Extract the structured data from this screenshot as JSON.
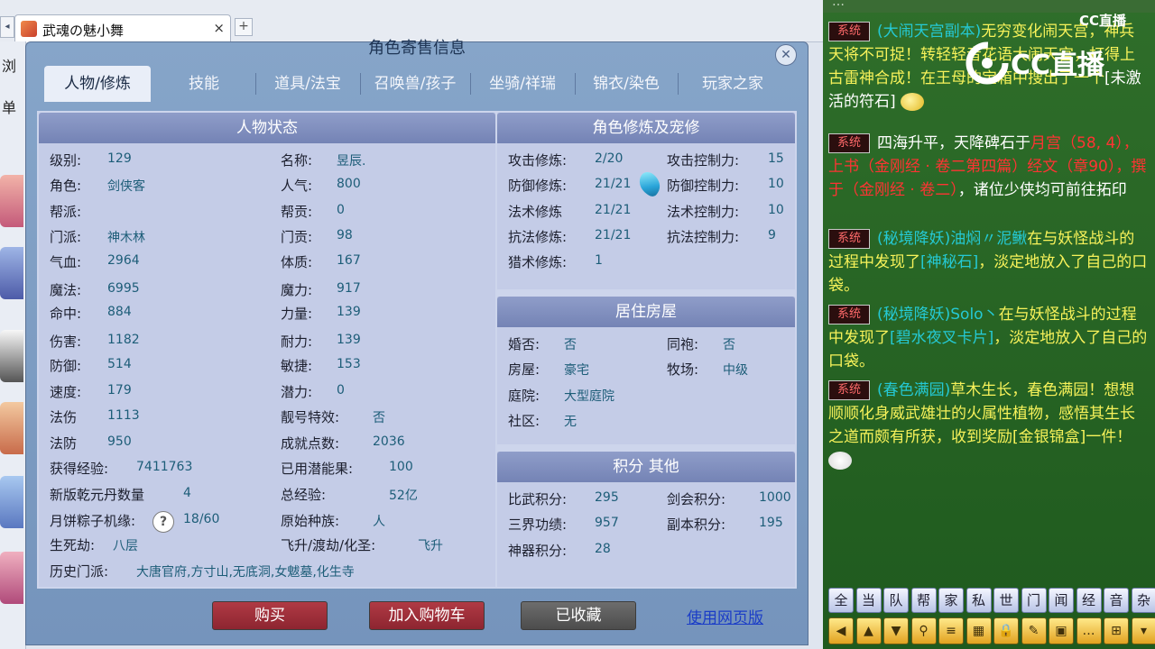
{
  "browser": {
    "tab_title": "武魂の魅小舞",
    "tab_close": "×",
    "new_tab": "+",
    "left_arrow": "◂",
    "side_labels": [
      "浏",
      "单"
    ]
  },
  "window": {
    "title": "角色寄售信息",
    "close": "✕",
    "tabs": [
      "人物/修炼",
      "技能",
      "道具/法宝",
      "召唤兽/孩子",
      "坐骑/祥瑞",
      "锦衣/染色",
      "玩家之家"
    ],
    "active_tab": 0
  },
  "status": {
    "heading": "人物状态",
    "left": [
      {
        "label": "级别:",
        "value": "129"
      },
      {
        "label": "角色:",
        "value": "剑侠客"
      },
      {
        "label": "帮派:",
        "value": ""
      },
      {
        "label": "门派:",
        "value": "神木林"
      },
      {
        "label": "气血:",
        "value": "2964"
      },
      {
        "label": "魔法:",
        "value": "6995"
      },
      {
        "label": "命中:",
        "value": "884"
      },
      {
        "label": "伤害:",
        "value": "1182"
      },
      {
        "label": "防御:",
        "value": "514"
      },
      {
        "label": "速度:",
        "value": "179"
      },
      {
        "label": "法伤",
        "value": "1113"
      },
      {
        "label": "法防",
        "value": "950"
      },
      {
        "label": "获得经验:",
        "value": "7411763"
      },
      {
        "label": "新版乾元丹数量",
        "value": "4"
      },
      {
        "label": "月饼粽子机缘:",
        "value": "18/60"
      },
      {
        "label": "生死劫:",
        "value": "八层"
      }
    ],
    "right": [
      {
        "label": "名称:",
        "value": "昱辰."
      },
      {
        "label": "人气:",
        "value": "800"
      },
      {
        "label": "帮贡:",
        "value": "0"
      },
      {
        "label": "门贡:",
        "value": "98"
      },
      {
        "label": "体质:",
        "value": "167"
      },
      {
        "label": "魔力:",
        "value": "917"
      },
      {
        "label": "力量:",
        "value": "139"
      },
      {
        "label": "耐力:",
        "value": "139"
      },
      {
        "label": "敏捷:",
        "value": "153"
      },
      {
        "label": "潜力:",
        "value": "0"
      },
      {
        "label": "靓号特效:",
        "value": "否"
      },
      {
        "label": "成就点数:",
        "value": "2036"
      },
      {
        "label": "已用潜能果:",
        "value": "100"
      },
      {
        "label": "总经验:",
        "value": "52亿"
      },
      {
        "label": "原始种族:",
        "value": "人"
      },
      {
        "label": "飞升/渡劫/化圣:",
        "value": "飞升"
      }
    ],
    "history_label": "历史门派:",
    "history_value": "大唐官府,方寸山,无底洞,女魃墓,化生寺",
    "help_icon": "?"
  },
  "cultivation": {
    "heading": "角色修炼及宠修",
    "left": [
      {
        "label": "攻击修炼:",
        "value": "2/20"
      },
      {
        "label": "防御修炼:",
        "value": "21/21"
      },
      {
        "label": "法术修炼",
        "value": "21/21"
      },
      {
        "label": "抗法修炼:",
        "value": "21/21"
      },
      {
        "label": "猎术修炼:",
        "value": "1"
      }
    ],
    "right": [
      {
        "label": "攻击控制力:",
        "value": "15"
      },
      {
        "label": "防御控制力:",
        "value": "10"
      },
      {
        "label": "法术控制力:",
        "value": "10"
      },
      {
        "label": "抗法控制力:",
        "value": "9"
      }
    ]
  },
  "residence": {
    "heading": "居住房屋",
    "rows": [
      {
        "label": "婚否:",
        "value": "否",
        "label2": "同袍:",
        "value2": "否"
      },
      {
        "label": "房屋:",
        "value": "豪宅",
        "label2": "牧场:",
        "value2": "中级"
      },
      {
        "label": "庭院:",
        "value": "大型庭院"
      },
      {
        "label": "社区:",
        "value": "无"
      }
    ]
  },
  "points": {
    "heading": "积分 其他",
    "rows": [
      {
        "label": "比武积分:",
        "value": "295",
        "label2": "剑会积分:",
        "value2": "1000"
      },
      {
        "label": "三界功绩:",
        "value": "957",
        "label2": "副本积分:",
        "value2": "195"
      },
      {
        "label": "神器积分:",
        "value": "28"
      }
    ]
  },
  "actions": {
    "buy": "购买",
    "add_cart": "加入购物车",
    "favorited": "已收藏",
    "web_link": "使用网页版"
  },
  "chat": {
    "top_text": "…",
    "badge": "系统",
    "logo_text": "CC直播",
    "logo_small": "CC直播",
    "messages": [
      {
        "prefix": "(大闹天宫副本)",
        "body": "无穷变化闹天宫，神兵天将不可捉！转轻轻音花语大闹天宫，打得上古雷神合成！在王母的宝箱中搜出了一个",
        "item": "[未激活的符石]"
      },
      {
        "pre": "四海升平，天降碑石于",
        "place": "月宫（58, 4），上书（金刚经 · 卷二第四篇）经文（章90），撰于（金刚经 · 卷二）",
        "post": "，诸位少侠均可前往拓印"
      },
      {
        "prefix": "(秘境降妖)",
        "name": "油焖〃泥鳅",
        "body": "在与妖怪战斗的过程中发现了",
        "item": "[神秘石]",
        "tail": "，淡定地放入了自己的口袋。"
      },
      {
        "prefix": "(秘境降妖)",
        "name": "Solo丶",
        "body": "在与妖怪战斗的过程中发现了",
        "item": "[碧水夜叉卡片]",
        "tail": "，淡定地放入了自己的口袋。"
      },
      {
        "prefix": "(春色满园)",
        "body": "草木生长，春色满园！想想顺顺化身威武雄壮的火属性植物，感悟其生长之道而颇有所获，收到奖励",
        "item": "[金银锦盒]",
        "tail": "一件！"
      }
    ],
    "channels": [
      "全",
      "当",
      "队",
      "帮",
      "家",
      "私",
      "世",
      "门",
      "闻",
      "经",
      "音",
      "杂"
    ],
    "tools": [
      "◀",
      "▲",
      "▼",
      "⚲",
      "≡",
      "▦",
      "🔒",
      "✎",
      "▣",
      "…",
      "⊞",
      "▾"
    ]
  },
  "colors": {
    "tab_header": "#7483b5",
    "value_text": "#1d5d78",
    "button_red": "#8d2530",
    "chat_bg": "#2f6e2a",
    "system_red": "#ff3333"
  }
}
